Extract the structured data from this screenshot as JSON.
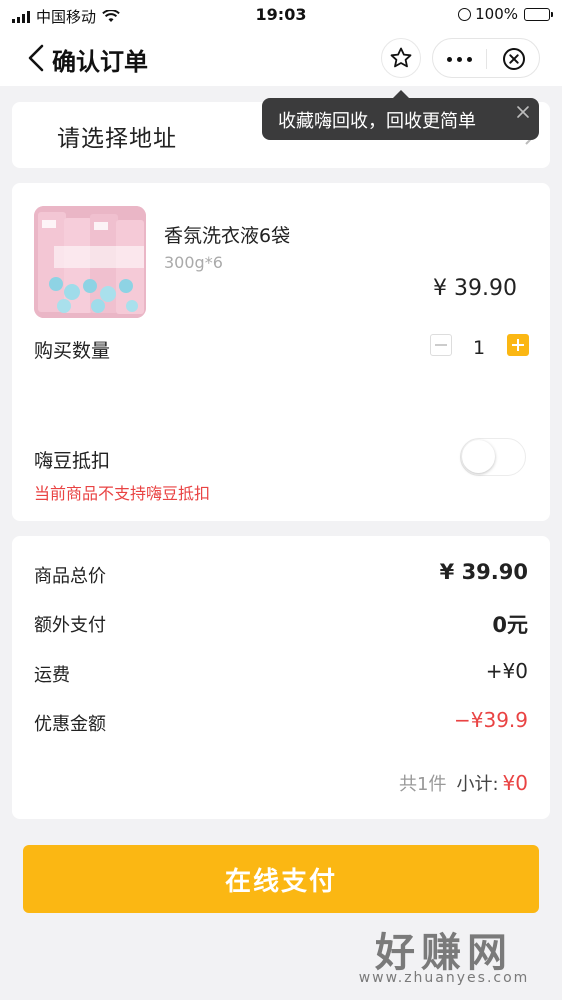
{
  "status_bar": {
    "carrier": "中国移动",
    "time": "19:03",
    "battery": "100%"
  },
  "nav": {
    "title": "确认订单",
    "icons": [
      "back-chevron-icon",
      "star-icon",
      "more-dots-icon",
      "close-circle-icon"
    ]
  },
  "address": {
    "placeholder": "请选择地址"
  },
  "tooltip": {
    "text": "收藏嗨回收，回收更简单"
  },
  "product": {
    "name": "香氛洗衣液6袋",
    "spec": "300g*6",
    "price": "¥ 39.90",
    "quantity_label": "购买数量",
    "quantity": "1",
    "haidou_label": "嗨豆抵扣",
    "haidou_note": "当前商品不支持嗨豆抵扣",
    "haidou_enabled": false
  },
  "summary": {
    "rows": [
      {
        "label": "商品总价",
        "value": "¥ 39.90"
      },
      {
        "label": "额外支付",
        "value": "0元"
      },
      {
        "label": "运费",
        "value": "+¥0"
      },
      {
        "label": "优惠金额",
        "value": "−¥39.9"
      }
    ],
    "count": "共1件",
    "subtotal_label": "小计:",
    "subtotal_value": "¥0"
  },
  "pay_button": "在线支付",
  "watermark": {
    "brand": "好赚网",
    "url": "www.zhuanyes.com"
  },
  "colors": {
    "accent": "#fbb713",
    "discount_red": "#e94343",
    "tooltip_bg": "#3b3b3c",
    "page_bg": "#f2f2f4"
  }
}
